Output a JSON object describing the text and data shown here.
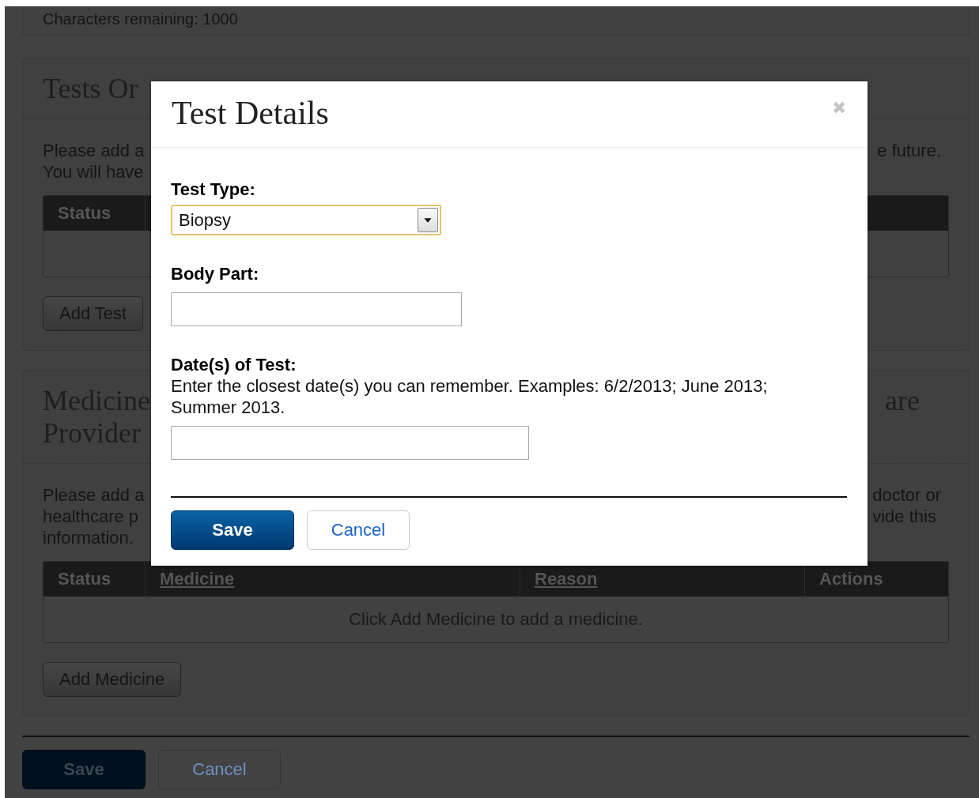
{
  "page": {
    "note_card": {
      "counter": "Characters remaining:  1000"
    },
    "tests_section": {
      "heading": "Tests Or",
      "description_left": [
        "Please add a",
        "You will have"
      ],
      "description_right": [
        "e future."
      ],
      "table": {
        "columns": [
          {
            "label": "Status",
            "sortable": false
          }
        ]
      },
      "add_button": "Add Test"
    },
    "medicine_section": {
      "heading_left": [
        "Medicine",
        "Provider"
      ],
      "heading_right": [
        "are"
      ],
      "description_left": [
        "Please add a",
        "healthcare p",
        "information."
      ],
      "description_right": [
        "doctor or",
        "vide this"
      ],
      "table": {
        "columns": [
          {
            "label": "Status",
            "sortable": false
          },
          {
            "label": "Medicine",
            "sortable": true
          },
          {
            "label": "Reason",
            "sortable": true
          },
          {
            "label": "Actions",
            "sortable": false
          }
        ],
        "empty_message": "Click Add Medicine to add a medicine."
      },
      "add_button": "Add Medicine"
    },
    "actions": {
      "save": "Save",
      "cancel": "Cancel"
    }
  },
  "dialog": {
    "title": "Test Details",
    "close": "✖",
    "fields": [
      {
        "kind": "select",
        "label": "Test Type:",
        "value": "Biopsy",
        "focused": true
      },
      {
        "kind": "text",
        "label": "Body Part:",
        "wide": false
      },
      {
        "kind": "text",
        "label": "Date(s) of Test:",
        "hint": "Enter the closest date(s) you can remember. Examples: 6/2/2013; June 2013; Summer 2013.",
        "wide": true
      }
    ],
    "buttons": {
      "save": "Save",
      "cancel": "Cancel"
    }
  }
}
